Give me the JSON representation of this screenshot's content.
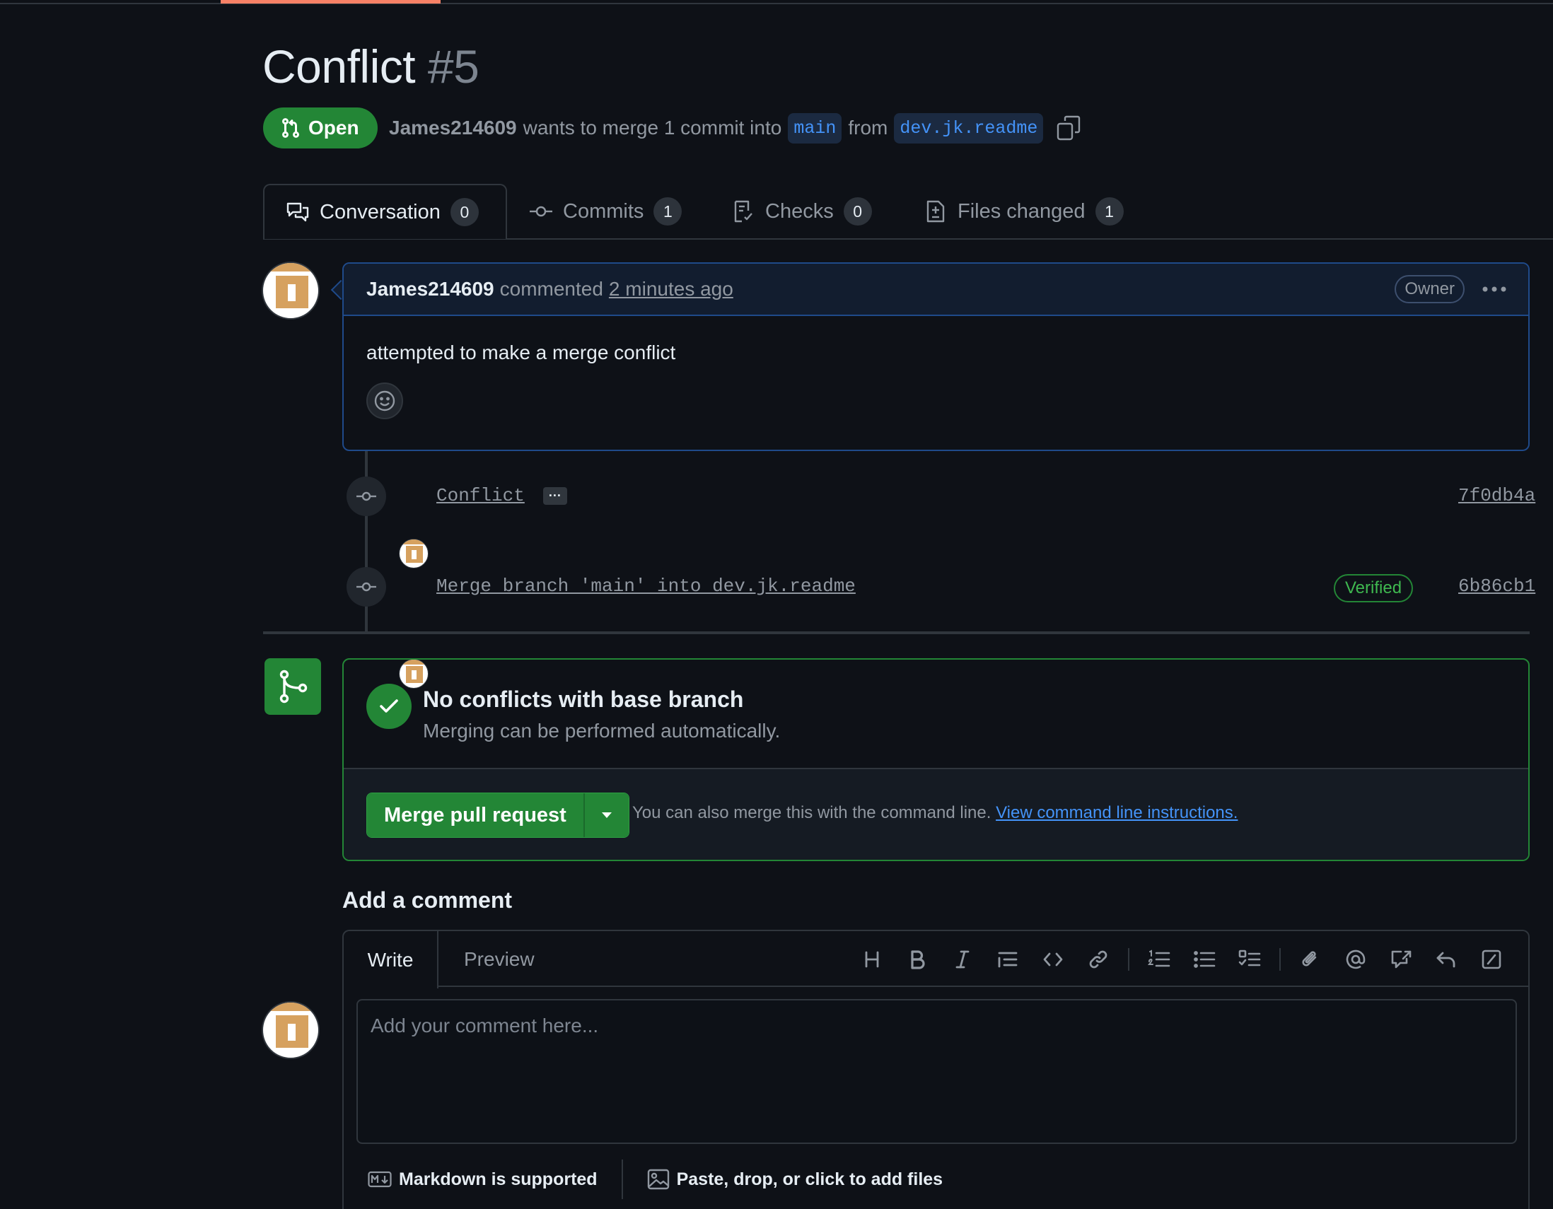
{
  "pr": {
    "title": "Conflict",
    "number": "#5",
    "state": "Open",
    "author": "James214609",
    "merge_text": "wants to merge 1 commit into",
    "base_branch": "main",
    "from_text": "from",
    "head_branch": "dev.jk.readme"
  },
  "tabs": [
    {
      "label": "Conversation",
      "count": "0",
      "icon": "comment-discussion-icon"
    },
    {
      "label": "Commits",
      "count": "1",
      "icon": "git-commit-icon"
    },
    {
      "label": "Checks",
      "count": "0",
      "icon": "checklist-icon"
    },
    {
      "label": "Files changed",
      "count": "1",
      "icon": "file-diff-icon"
    }
  ],
  "comment": {
    "author": "James214609",
    "action": "commented",
    "time": "2 minutes ago",
    "role": "Owner",
    "body": "attempted to make a merge conflict"
  },
  "commits": [
    {
      "message": "Conflict",
      "sha": "7f0db4a",
      "verified": ""
    },
    {
      "message": "Merge branch 'main' into dev.jk.readme",
      "sha": "6b86cb1",
      "verified": "Verified"
    }
  ],
  "merge": {
    "title": "No conflicts with base branch",
    "subtitle": "Merging can be performed automatically.",
    "button": "Merge pull request",
    "note": "You can also merge this with the command line.",
    "link": "View command line instructions."
  },
  "add_comment": {
    "title": "Add a comment",
    "write_tab": "Write",
    "preview_tab": "Preview",
    "placeholder": "Add your comment here...",
    "markdown_note": "Markdown is supported",
    "files_note": "Paste, drop, or click to add files"
  },
  "colors": {
    "background": "#0e1117",
    "accent_green": "#238636",
    "link_blue": "#4493f8",
    "tab_accent": "#f78166"
  }
}
